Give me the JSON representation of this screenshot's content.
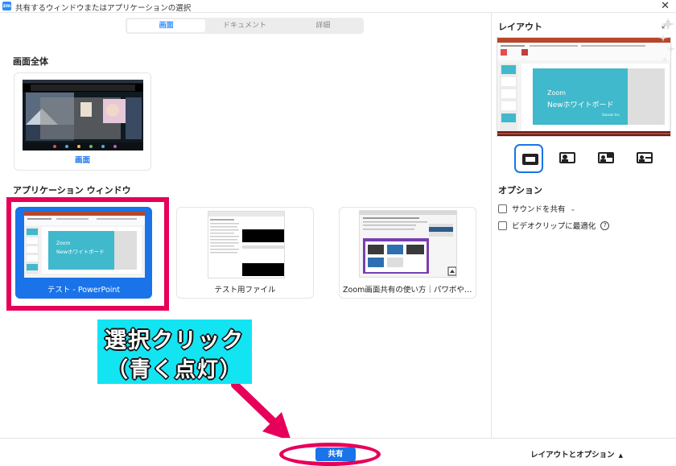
{
  "window": {
    "title": "共有するウィンドウまたはアプリケーションの選択",
    "app_icon": "zm",
    "close_glyph": "✕"
  },
  "tabs": [
    {
      "label": "画面",
      "active": true
    },
    {
      "label": "ドキュメント",
      "active": false
    },
    {
      "label": "詳細",
      "active": false
    }
  ],
  "screen_section": {
    "title": "画面全体",
    "items": [
      {
        "label": "画面"
      }
    ]
  },
  "apps_section": {
    "title": "アプリケーション ウィンドウ",
    "items": [
      {
        "label": "テスト - PowerPoint",
        "selected": true,
        "slide_text_1": "Zoom",
        "slide_text_2": "Newホワイトボード"
      },
      {
        "label": "テスト用ファイル",
        "selected": false
      },
      {
        "label": "Zoom画面共有の使い方｜パワポやホワ...",
        "selected": false
      }
    ]
  },
  "annotation": {
    "line1": "選択クリック",
    "line2": "（青く点灯）",
    "highlight_color": "#e6005a",
    "label_bg": "#13e4f2"
  },
  "layout_panel": {
    "title": "レイアウト",
    "preview_text_1": "Zoom",
    "preview_text_2": "Newホワイトボード",
    "layout_options": [
      {
        "icon": "screen-only-icon",
        "selected": true
      },
      {
        "icon": "screen-with-side-video-icon",
        "selected": false
      },
      {
        "icon": "screen-with-corner-video-icon",
        "selected": false
      },
      {
        "icon": "screen-with-pip-video-icon",
        "selected": false
      }
    ]
  },
  "options_panel": {
    "title": "オプション",
    "items": [
      {
        "label": "サウンドを共有",
        "checked": false,
        "has_dropdown": true
      },
      {
        "label": "ビデオクリップに最適化",
        "checked": false,
        "has_help": true
      }
    ]
  },
  "footer": {
    "share_label": "共有",
    "layout_options_label": "レイアウトとオプション",
    "accent_color": "#1a73e8"
  }
}
